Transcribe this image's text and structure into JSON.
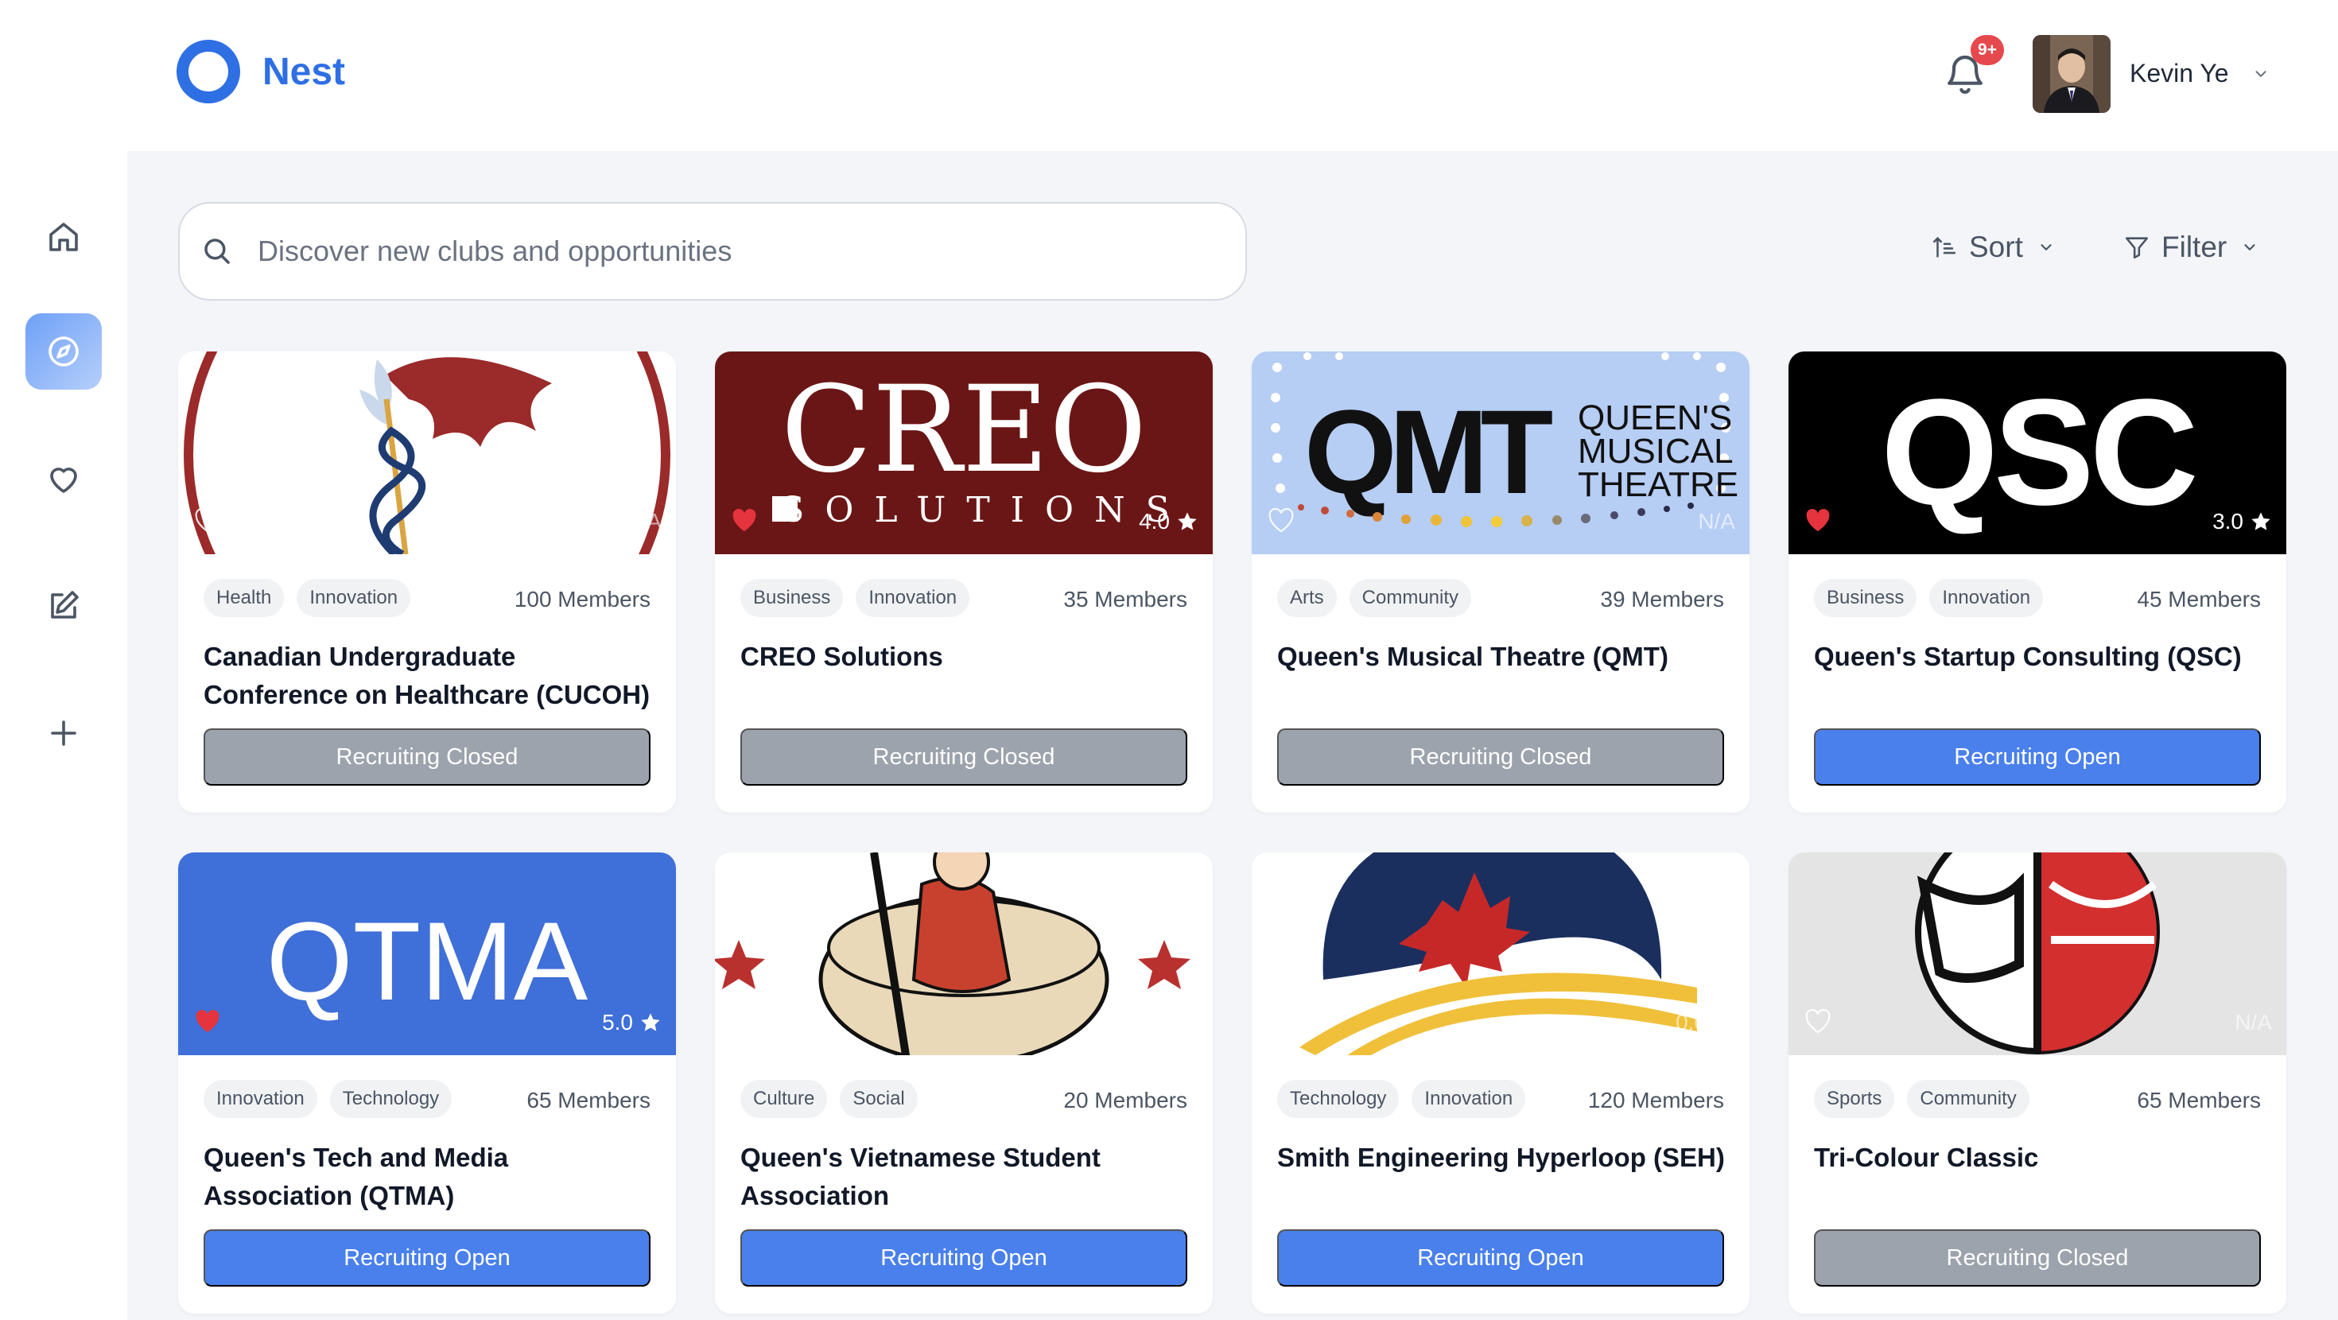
{
  "brand": {
    "name": "Nest",
    "color": "#2f6fe4"
  },
  "header": {
    "notifications_badge": "9+",
    "user_name": "Kevin Ye"
  },
  "sidebar": {
    "items": [
      {
        "name": "home",
        "icon": "home-icon"
      },
      {
        "name": "explore",
        "icon": "compass-icon",
        "active": true
      },
      {
        "name": "favorites",
        "icon": "heart-icon"
      },
      {
        "name": "edit",
        "icon": "edit-icon"
      },
      {
        "name": "create",
        "icon": "plus-icon"
      }
    ]
  },
  "search": {
    "placeholder": "Discover new clubs and opportunities"
  },
  "toolbar": {
    "sort_label": "Sort",
    "filter_label": "Filter"
  },
  "clubs": [
    {
      "name": "Canadian Undergraduate Conference on Healthcare (CUCOH)",
      "tags": [
        "Health",
        "Innovation"
      ],
      "members": "100 Members",
      "rating": "N/A",
      "favorited": false,
      "status": "Recruiting Closed"
    },
    {
      "name": "CREO Solutions",
      "tags": [
        "Business",
        "Innovation"
      ],
      "members": "35 Members",
      "rating": "4.0",
      "favorited": true,
      "status": "Recruiting Closed",
      "banner_text": [
        "CREO",
        "SOLUTIONS"
      ]
    },
    {
      "name": "Queen's Musical Theatre (QMT)",
      "tags": [
        "Arts",
        "Community"
      ],
      "members": "39 Members",
      "rating": "N/A",
      "favorited": false,
      "status": "Recruiting Closed",
      "banner_text": [
        "QMT",
        "QUEEN'S",
        "MUSICAL",
        "THEATRE"
      ]
    },
    {
      "name": "Queen's Startup Consulting (QSC)",
      "tags": [
        "Business",
        "Innovation"
      ],
      "members": "45 Members",
      "rating": "3.0",
      "favorited": true,
      "status": "Recruiting Open",
      "banner_text": [
        "QSC"
      ]
    },
    {
      "name": "Queen's Tech and Media Association (QTMA)",
      "tags": [
        "Innovation",
        "Technology"
      ],
      "members": "65 Members",
      "rating": "5.0",
      "favorited": true,
      "status": "Recruiting Open",
      "banner_text": [
        "QTMA"
      ]
    },
    {
      "name": "Queen's Vietnamese Student Association",
      "tags": [
        "Culture",
        "Social"
      ],
      "members": "20 Members",
      "rating": "",
      "favorited": false,
      "status": "Recruiting Open"
    },
    {
      "name": "Smith Engineering Hyperloop (SEH)",
      "tags": [
        "Technology",
        "Innovation"
      ],
      "members": "120 Members",
      "rating": "0.0",
      "favorited": false,
      "status": "Recruiting Open"
    },
    {
      "name": "Tri-Colour Classic",
      "tags": [
        "Sports",
        "Community"
      ],
      "members": "65 Members",
      "rating": "N/A",
      "favorited": false,
      "status": "Recruiting Closed"
    }
  ],
  "colors": {
    "open": "#4a80ec",
    "closed": "#9ca3ad",
    "favorite": "#e5343d",
    "background": "#f3f5f9"
  }
}
